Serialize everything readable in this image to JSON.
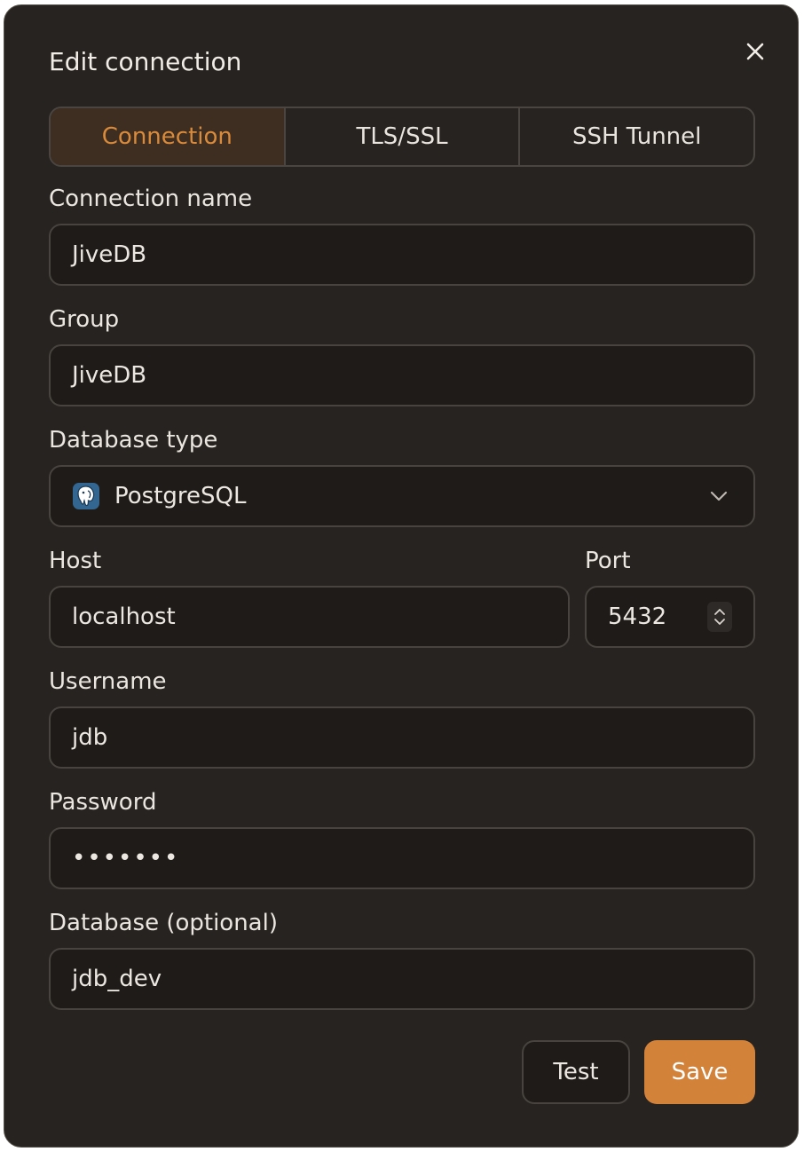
{
  "dialog": {
    "title": "Edit connection",
    "close_icon": "close-icon"
  },
  "tabs": [
    {
      "label": "Connection",
      "active": true
    },
    {
      "label": "TLS/SSL",
      "active": false
    },
    {
      "label": "SSH Tunnel",
      "active": false
    }
  ],
  "form": {
    "connection_name": {
      "label": "Connection name",
      "value": "JiveDB"
    },
    "group": {
      "label": "Group",
      "value": "JiveDB"
    },
    "database_type": {
      "label": "Database type",
      "value": "PostgreSQL",
      "icon": "postgresql-icon"
    },
    "host": {
      "label": "Host",
      "value": "localhost"
    },
    "port": {
      "label": "Port",
      "value": "5432"
    },
    "username": {
      "label": "Username",
      "value": "jdb"
    },
    "password": {
      "label": "Password",
      "value": "•••••••"
    },
    "database": {
      "label": "Database (optional)",
      "value": "jdb_dev"
    }
  },
  "actions": {
    "test_label": "Test",
    "save_label": "Save"
  },
  "colors": {
    "background": "#262320",
    "accent": "#d3823a",
    "active_tab_text": "#d98a3a",
    "field_background": "#1e1b19"
  }
}
